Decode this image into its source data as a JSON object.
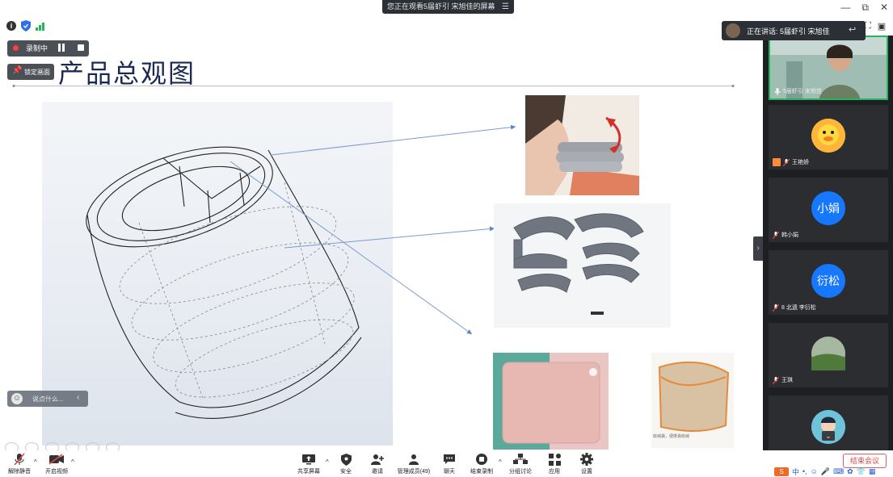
{
  "top_banner": {
    "sharing_text": "您正在观看5届虾引 宋旭佳的屏幕",
    "menu_icon": "menu-icon"
  },
  "window_controls": {
    "minimize": "—",
    "restore": "⧉",
    "close": "✕"
  },
  "status_icons": [
    "info-icon",
    "shield-icon",
    "signal-icon"
  ],
  "recording": {
    "label": "录制中",
    "lock_label": "锁定画面"
  },
  "speaking": {
    "label": "正在讲话: 5届虾引 宋旭佳"
  },
  "slide": {
    "title": "产品总观图"
  },
  "pouch_caption": "收纳袋，便携易收纳",
  "chat": {
    "placeholder": "说点什么..."
  },
  "participants": [
    {
      "name": "5届虾引 宋旭佳",
      "avatar_text": ""
    },
    {
      "name": "王艳娇",
      "avatar_text": ""
    },
    {
      "name": "韩小娟",
      "avatar_text": "小娟"
    },
    {
      "name": "8 北遗 李衍松",
      "avatar_text": "衍松"
    },
    {
      "name": "王琪",
      "avatar_text": ""
    }
  ],
  "toolbar": {
    "unmute": "解除静音",
    "start_video": "开启视频",
    "share_screen": "共享屏幕",
    "security": "安全",
    "invite": "邀请",
    "manage_members": "管理成员(49)",
    "chat": "聊天",
    "end_recording": "结束录制",
    "breakout": "分组讨论",
    "apps": "应用",
    "settings": "设置",
    "end_meeting": "结束会议"
  },
  "ime": {
    "logo": "S",
    "mode": "中"
  },
  "colors": {
    "accent_green": "#27b45b",
    "end_red": "#e14848",
    "avatar_blue": "#1677ff",
    "panel_bg": "#1e1f22"
  }
}
